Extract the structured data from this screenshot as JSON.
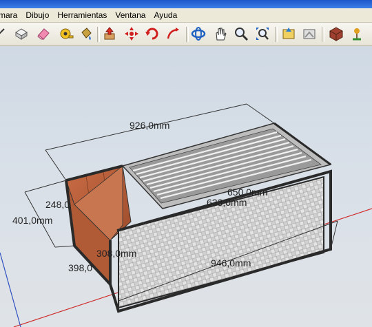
{
  "menu": {
    "items": [
      "mara",
      "Dibujo",
      "Herramientas",
      "Ventana",
      "Ayuda"
    ]
  },
  "toolbar": {
    "icons": [
      "open-box-icon",
      "eraser-icon",
      "tape-measure-icon",
      "paint-bucket-icon",
      "push-pull-icon",
      "move-icon",
      "rotate-icon",
      "follow-me-icon",
      "orbit-icon",
      "pan-icon",
      "zoom-icon",
      "zoom-extents-icon",
      "get-models-icon",
      "share-model-icon",
      "components-icon",
      "geo-location-icon"
    ]
  },
  "dimensions": {
    "top_length": "926,0mm",
    "front_length": "946,0mm",
    "height": "401,0mm",
    "depth": "398,0",
    "inner_height": "248,0",
    "inner_depth": "308,0mm",
    "grill_width": "650,0mm",
    "grill_length": "633,0mm"
  },
  "colors": {
    "title_bar": "#2a66d8",
    "menu_bg": "#ece9d8",
    "wood": "#b85f3a",
    "frame": "#3a3a3a",
    "plate": "#c9c9c9",
    "axis_red": "#d03030",
    "axis_blue": "#3050c0"
  }
}
